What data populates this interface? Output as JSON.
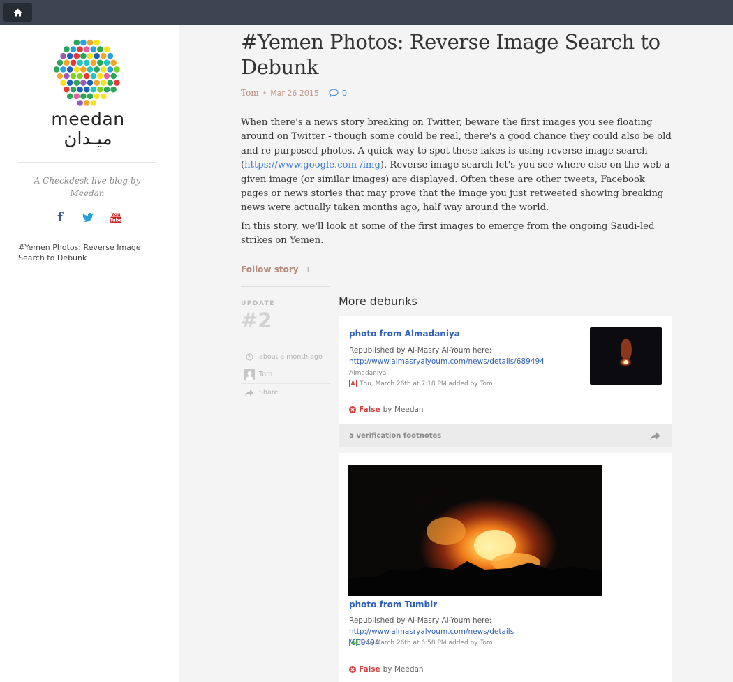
{
  "topbar": {
    "home_icon": "home-icon"
  },
  "sidebar": {
    "logo_text": "meedan",
    "logo_arabic": "ميـدان",
    "tagline": "A Checkdesk live blog by Meedan",
    "social": [
      {
        "name": "facebook-icon",
        "glyph": "f",
        "color": "#3b5998"
      },
      {
        "name": "twitter-icon",
        "glyph": "t",
        "color": "#2a9fd6"
      },
      {
        "name": "youtube-icon",
        "glyph": "You Tube",
        "color": "#cc2222"
      }
    ],
    "story_link": "#Yemen Photos: Reverse Image Search to Debunk",
    "logo_colors": [
      "#e53a3a",
      "#f5a623",
      "#f8e21c",
      "#7ed321",
      "#2aa55a",
      "#29a3e0",
      "#1e5fb8",
      "#9b59b6",
      "#e85d9a",
      "#23c4c4"
    ]
  },
  "post": {
    "title": "#Yemen Photos: Reverse Image Search to Debunk",
    "author": "Tom",
    "date": "Mar 26 2015",
    "comment_count": "0",
    "paragraph1_a": "When there's a news story breaking on Twitter, beware the first images you see floating around on Twitter - though some could be real, there's a good chance they could also be old and re-purposed photos. A quick way to spot these fakes is using reverse image search (",
    "paragraph1_link": "https://www.google.com /img",
    "paragraph1_b": "). Reverse image search let's you see where else on the web a given image (or similar images) are displayed. Often these are other tweets, Facebook pages or news stories that may prove that the image you just retweeted showing breaking news were actually taken months ago, half way around the world.",
    "paragraph2": "In this story, we'll look at some of the first images to emerge from the ongoing Saudi-led strikes on Yemen.",
    "follow_label": "Follow story",
    "follow_count": "1"
  },
  "update": {
    "label": "UPDATE",
    "number": "#2",
    "time": "about a month ago",
    "author": "Tom",
    "share": "Share"
  },
  "section": {
    "title": "More debunks"
  },
  "cards": [
    {
      "title": "photo from Almadaniya",
      "line1": "Republished by Al-Masry Al-Youm here:",
      "link": "http://www.almasryalyoum.com/news/details/689494",
      "source": "Almadaniya",
      "badge": "A",
      "badge_color": "#d04040",
      "added": "Thu, March 26th at 7:18 PM added by Tom",
      "status": "False",
      "status_by": "by Meedan",
      "footnotes": "5 verification footnotes"
    },
    {
      "title": "photo from Tumblr",
      "line1": "Republished by Al-Masry Al-Youm here:",
      "link_a": "http://www.almasryalyoum.com/news/details",
      "link_b": "/689494",
      "badge": "4",
      "badge_color": "#3aa83a",
      "added": "Thu, March 26th at 6:58 PM added by Tom",
      "status": "False",
      "status_by": "by Meedan"
    }
  ]
}
